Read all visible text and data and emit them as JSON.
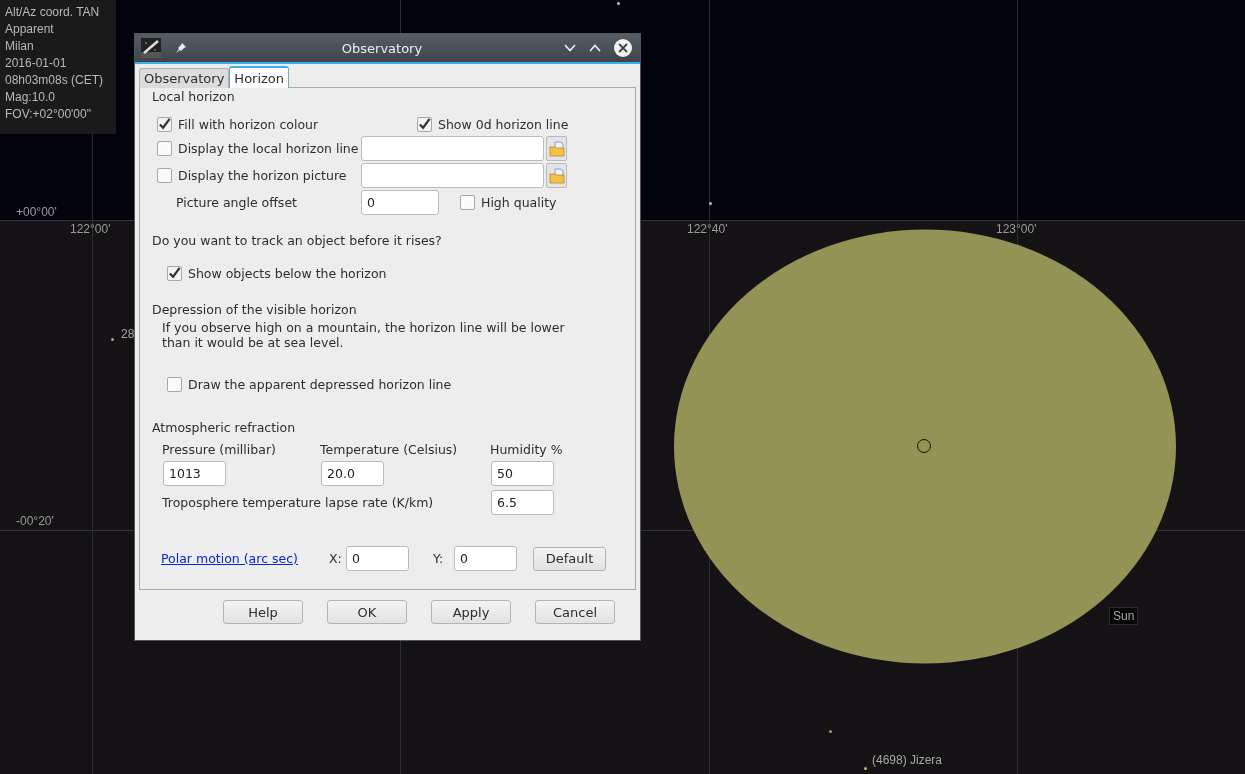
{
  "sky_map": {
    "info": [
      "Alt/Az coord. TAN",
      "Apparent",
      "Milan",
      "2016-01-01",
      "08h03m08s (CET)",
      "Mag:10.0",
      "FOV:+02°00'00\""
    ],
    "grid_labels": [
      "+00°00'",
      "122°00'",
      "122°40'",
      "123°00'",
      "-00°20'"
    ],
    "object_labels": [
      {
        "text": "28",
        "kind": "plain"
      },
      {
        "text": "Sun",
        "kind": "boxed"
      },
      {
        "text": "(4698) Jizera",
        "kind": "plain"
      }
    ]
  },
  "dialog": {
    "title": "Observatory",
    "tabs": [
      {
        "label": "Observatory",
        "selected": false
      },
      {
        "label": "Horizon",
        "selected": true
      }
    ],
    "local_horizon": {
      "heading": "Local horizon",
      "fill_with_colour": {
        "label": "Fill with horizon colour",
        "checked": true
      },
      "show_0d_line": {
        "label": "Show 0d horizon line",
        "checked": true
      },
      "local_horizon_line": {
        "label": "Display the local horizon line",
        "checked": false
      },
      "horizon_picture": {
        "label": "Display the horizon picture",
        "checked": false
      },
      "angle_offset": {
        "label": "Picture angle offset",
        "value": "0"
      },
      "high_quality": {
        "label": "High quality",
        "checked": false
      }
    },
    "track": {
      "question": "Do you want to track an object before it rises?",
      "show_below": {
        "label": "Show objects below the horizon",
        "checked": true
      }
    },
    "depression": {
      "heading": "Depression of the visible horizon",
      "note": "If you observe high on a mountain, the horizon line will be lower than it would be at sea level.",
      "draw_line": {
        "label": "Draw the apparent depressed horizon line",
        "checked": false
      }
    },
    "refraction": {
      "heading": "Atmospheric refraction",
      "pressure": {
        "label": "Pressure (millibar)",
        "value": "1013"
      },
      "temperature": {
        "label": "Temperature (Celsius)",
        "value": "20.0"
      },
      "humidity": {
        "label": "Humidity %",
        "value": "50"
      },
      "lapse_rate": {
        "label": "Troposphere temperature lapse rate (K/km)",
        "value": "6.5"
      }
    },
    "polar_motion": {
      "link": "Polar motion (arc sec)",
      "x": {
        "label": "X:",
        "value": "0"
      },
      "y": {
        "label": "Y:",
        "value": "0"
      },
      "default_button": "Default"
    },
    "buttons": [
      "Help",
      "OK",
      "Apply",
      "Cancel"
    ]
  }
}
